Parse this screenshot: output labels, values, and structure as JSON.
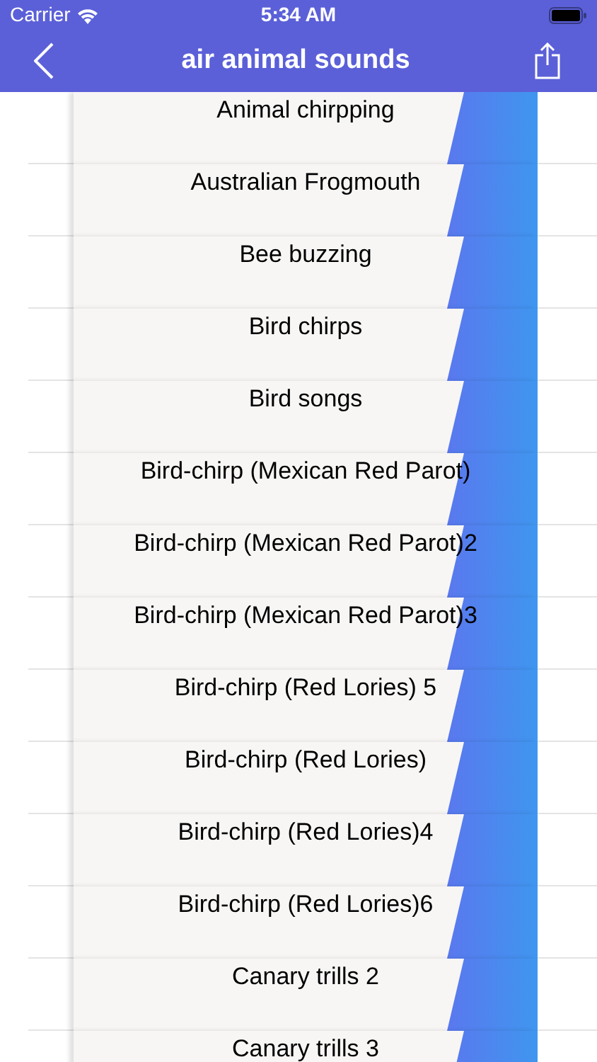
{
  "status_bar": {
    "carrier": "Carrier",
    "time": "5:34 AM"
  },
  "nav": {
    "title": "air animal sounds"
  },
  "sounds": [
    {
      "label": "Animal chirpping"
    },
    {
      "label": "Australian Frogmouth"
    },
    {
      "label": "Bee buzzing"
    },
    {
      "label": "Bird chirps"
    },
    {
      "label": "Bird songs"
    },
    {
      "label": "Bird-chirp (Mexican Red Parot)"
    },
    {
      "label": "Bird-chirp (Mexican Red Parot)2"
    },
    {
      "label": "Bird-chirp (Mexican Red Parot)3"
    },
    {
      "label": "Bird-chirp (Red Lories) 5"
    },
    {
      "label": "Bird-chirp (Red Lories)"
    },
    {
      "label": "Bird-chirp (Red Lories)4"
    },
    {
      "label": "Bird-chirp (Red Lories)6"
    },
    {
      "label": "Canary trills 2"
    },
    {
      "label": "Canary trills 3"
    }
  ]
}
